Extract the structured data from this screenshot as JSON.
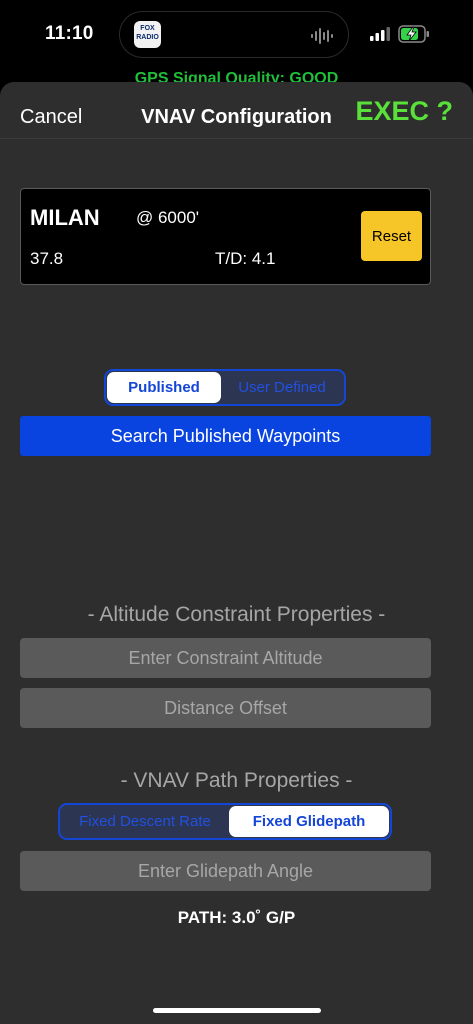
{
  "status_bar": {
    "time": "11:10",
    "island_app_label": "FOX RADIO",
    "signal_icon": "cellular-signal-icon",
    "battery_icon": "battery-charging-icon"
  },
  "gps_peek": "GPS Signal Quality: GOOD",
  "header": {
    "cancel_label": "Cancel",
    "title": "VNAV Configuration",
    "exec_label": "EXEC ?"
  },
  "waypoint": {
    "name": "MILAN",
    "altitude": "@ 6000'",
    "distance": "37.8",
    "td": "T/D: 4.1",
    "reset_label": "Reset"
  },
  "waypoint_source": {
    "options": [
      "Published",
      "User Defined"
    ],
    "selected": "Published"
  },
  "search_label": "Search Published Waypoints",
  "altitude_constraint": {
    "title": "- Altitude Constraint Properties -",
    "altitude_placeholder": "Enter Constraint Altitude",
    "offset_placeholder": "Distance Offset"
  },
  "vnav_path": {
    "title": "- VNAV Path Properties -",
    "options": [
      "Fixed Descent Rate",
      "Fixed Glidepath"
    ],
    "selected": "Fixed Glidepath",
    "angle_placeholder": "Enter Glidepath Angle",
    "readout": "PATH: 3.0˚ G/P"
  },
  "colors": {
    "accent_blue": "#0a44e0",
    "exec_green": "#5ae03a",
    "reset_yellow": "#f6c527",
    "sheet_bg": "#2e2e2e"
  }
}
